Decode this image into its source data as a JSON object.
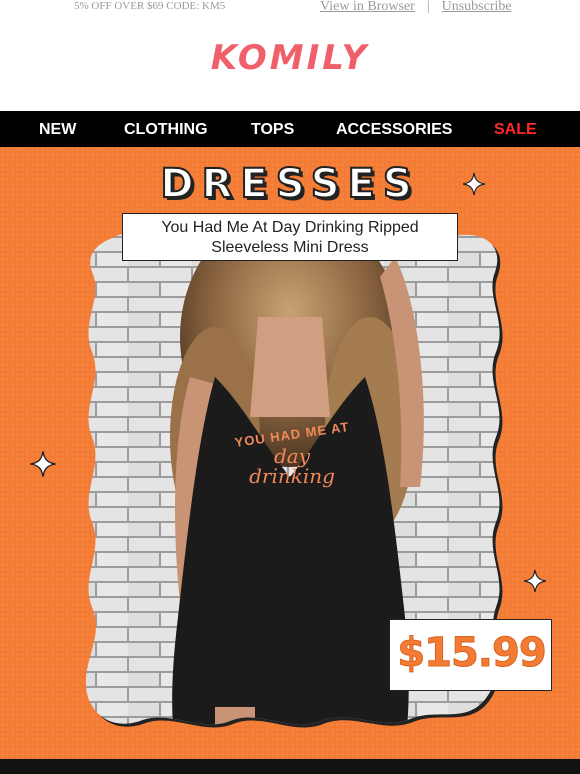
{
  "topbar": {
    "promo": "5% OFF OVER $69 CODE: KM5",
    "view_in_browser": "View in Browser",
    "separator": "|",
    "unsubscribe": "Unsubscribe"
  },
  "logo": "KOMILY",
  "nav": {
    "items": [
      {
        "label": "NEW"
      },
      {
        "label": "CLOTHING"
      },
      {
        "label": "TOPS"
      },
      {
        "label": "ACCESSORIES"
      },
      {
        "label": "SALE"
      }
    ]
  },
  "hero": {
    "title": "DRESSES",
    "product_name_line1": "You Had Me At Day Drinking Ripped",
    "product_name_line2": "Sleeveless Mini Dress",
    "shirt_text_line1": "YOU HAD ME AT",
    "shirt_text_line2": "day",
    "shirt_text_line3": "drinking",
    "price": "$15.99"
  },
  "colors": {
    "accent": "#f47b34",
    "nav_bg": "#000000",
    "sale": "#ff2a2a",
    "logo": "#f0606a"
  },
  "icons": [
    "sparkle-icon"
  ]
}
